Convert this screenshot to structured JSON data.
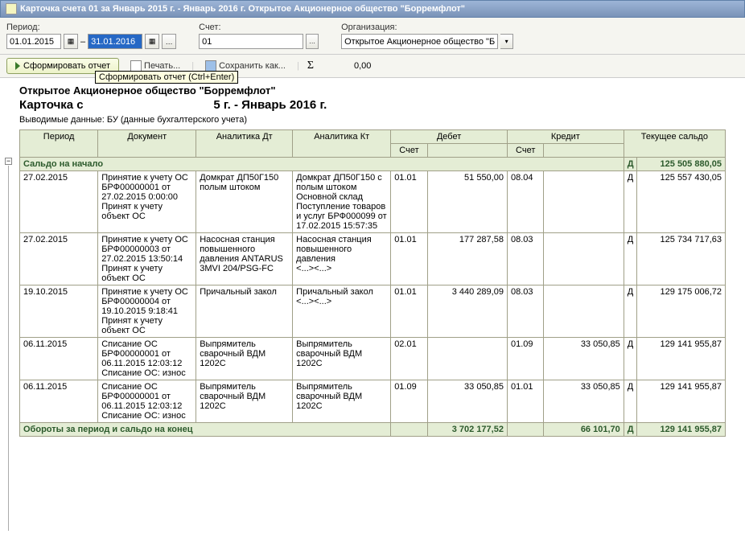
{
  "window": {
    "title": "Карточка счета 01 за Январь 2015 г. - Январь 2016 г. Открытое Акционерное общество \"Борремфлот\""
  },
  "params": {
    "period_label": "Период:",
    "date_from": "01.01.2015",
    "date_to": "31.01.2016",
    "dash": "–",
    "account_label": "Счет:",
    "account_value": "01",
    "org_label": "Организация:",
    "org_value": "Открытое Акционерное общество \"Бо"
  },
  "toolbar": {
    "generate": "Сформировать отчет",
    "tooltip": "Сформировать отчет (Ctrl+Enter)",
    "print": "Печать...",
    "save": "Сохранить как...",
    "sigma": "Σ",
    "sum": "0,00"
  },
  "report": {
    "org_title": "Открытое Акционерное общество \"Борремфлот\"",
    "title_left": "Карточка с",
    "title_right": "5 г. - Январь 2016 г.",
    "subtitle": "Выводимые данные:   БУ (данные бухгалтерского учета)"
  },
  "headers": {
    "period": "Период",
    "document": "Документ",
    "analytics_dt": "Аналитика Дт",
    "analytics_kt": "Аналитика Кт",
    "debit": "Дебет",
    "credit": "Кредит",
    "balance": "Текущее сальдо",
    "account": "Счет"
  },
  "opening": {
    "label": "Сальдо на начало",
    "dc": "Д",
    "amount": "125 505 880,05"
  },
  "rows": [
    {
      "period": "27.02.2015",
      "document": "Принятие к учету ОС БРФ00000001 от 27.02.2015 0:00:00\nПринят к учету объект ОС",
      "adt": "Домкрат ДП50Г150 полым штоком",
      "akt": "Домкрат ДП50Г150 с полым штоком\nОсновной склад\nПоступление товаров и услуг БРФ000099 от 17.02.2015 15:57:35",
      "d_acct": "01.01",
      "d_amt": "51 550,00",
      "c_acct": "08.04",
      "c_amt": "",
      "dc": "Д",
      "bal": "125 557 430,05"
    },
    {
      "period": "27.02.2015",
      "document": "Принятие к учету ОС БРФ00000003 от 27.02.2015 13:50:14\nПринят к учету объект ОС",
      "adt": "Насосная станция повышенного давления ANTARUS 3MVI 204/PSG-FC",
      "akt": "Насосная станция повышенного давления\n<...><...>",
      "d_acct": "01.01",
      "d_amt": "177 287,58",
      "c_acct": "08.03",
      "c_amt": "",
      "dc": "Д",
      "bal": "125 734 717,63"
    },
    {
      "period": "19.10.2015",
      "document": "Принятие к учету ОС БРФ00000004 от 19.10.2015 9:18:41\nПринят к учету объект ОС",
      "adt": "Причальный закол",
      "akt": "Причальный закол\n<...><...>",
      "d_acct": "01.01",
      "d_amt": "3 440 289,09",
      "c_acct": "08.03",
      "c_amt": "",
      "dc": "Д",
      "bal": "129 175 006,72"
    },
    {
      "period": "06.11.2015",
      "document": "Списание ОС БРФ00000001 от 06.11.2015 12:03:12\nСписание ОС: износ",
      "adt": "Выпрямитель сварочный ВДМ 1202С",
      "akt": "Выпрямитель сварочный ВДМ 1202С",
      "d_acct": "02.01",
      "d_amt": "",
      "c_acct": "01.09",
      "c_amt": "33 050,85",
      "dc": "Д",
      "bal": "129 141 955,87"
    },
    {
      "period": "06.11.2015",
      "document": "Списание ОС БРФ00000001 от 06.11.2015 12:03:12\nСписание ОС: износ",
      "adt": "Выпрямитель сварочный ВДМ 1202С",
      "akt": "Выпрямитель сварочный ВДМ 1202С",
      "d_acct": "01.09",
      "d_amt": "33 050,85",
      "c_acct": "01.01",
      "c_amt": "33 050,85",
      "dc": "Д",
      "bal": "129 141 955,87"
    }
  ],
  "closing": {
    "label": "Обороты за период и сальдо на конец",
    "d_total": "3 702 177,52",
    "c_total": "66 101,70",
    "dc": "Д",
    "bal": "129 141 955,87"
  }
}
